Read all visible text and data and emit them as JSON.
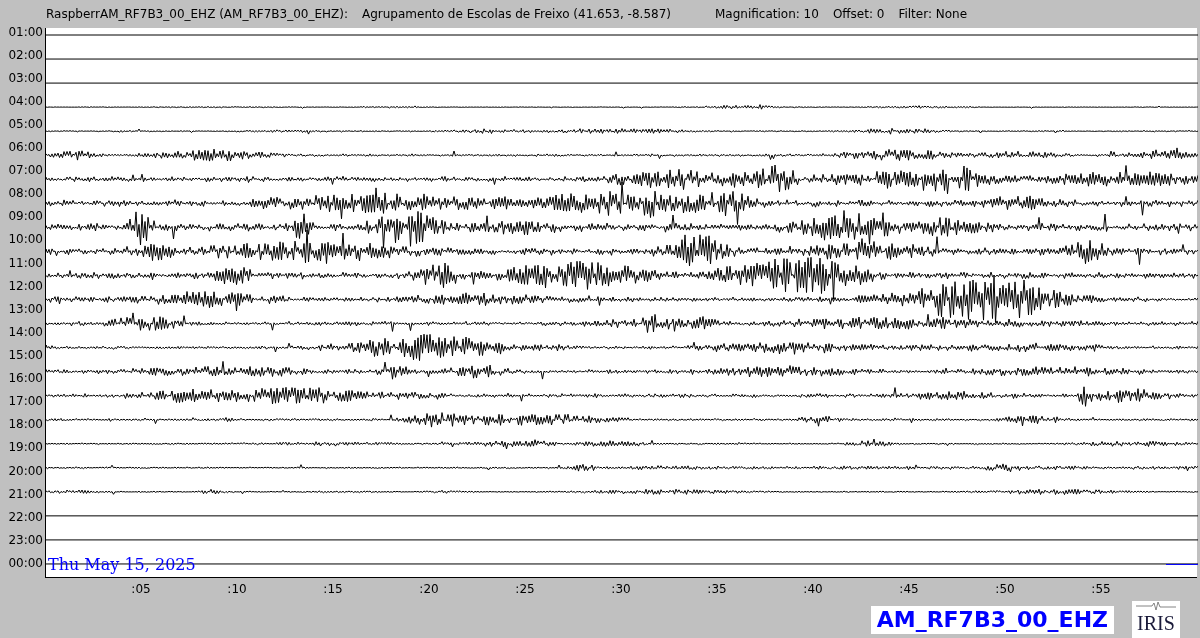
{
  "header": {
    "station": "RaspberrAM_RF7B3_00_EHZ (AM_RF7B3_00_EHZ):",
    "location": "Agrupamento de Escolas de Freixo (41.653, -8.587)",
    "magnification": "Magnification: 10",
    "offset": "Offset: 0",
    "filter": "Filter: None"
  },
  "hours": [
    "01:00",
    "02:00",
    "03:00",
    "04:00",
    "05:00",
    "06:00",
    "07:00",
    "08:00",
    "09:00",
    "10:00",
    "11:00",
    "12:00",
    "13:00",
    "14:00",
    "15:00",
    "16:00",
    "17:00",
    "18:00",
    "19:00",
    "20:00",
    "21:00",
    "22:00",
    "23:00",
    "00:00"
  ],
  "date": "Thu May 15, 2025",
  "minute_ticks": [
    ":05",
    ":10",
    ":15",
    ":20",
    ":25",
    ":30",
    ":35",
    ":40",
    ":45",
    ":50",
    ":55"
  ],
  "channel_label": "AM_RF7B3_00_EHZ",
  "logo": "IRIS"
}
